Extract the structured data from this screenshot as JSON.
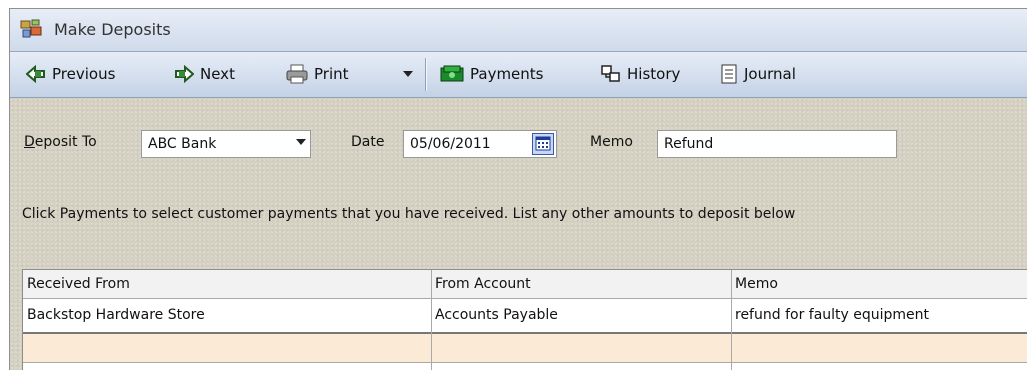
{
  "window": {
    "title": "Make Deposits",
    "icon": "make-deposits-icon"
  },
  "toolbar": {
    "previous_label": "Previous",
    "next_label": "Next",
    "print_label": "Print",
    "payments_label": "Payments",
    "history_label": "History",
    "journal_label": "Journal"
  },
  "form": {
    "deposit_to_label_first": "D",
    "deposit_to_label_rest": "eposit To",
    "deposit_to_value": "ABC Bank",
    "date_label": "Date",
    "date_value": "05/06/2011",
    "memo_label": "Memo",
    "memo_value": "Refund",
    "instructions": "Click Payments to select customer payments that you have received. List any other amounts to deposit below"
  },
  "grid": {
    "columns": [
      "Received From",
      "From Account",
      "Memo"
    ],
    "rows": [
      [
        "Backstop Hardware Store",
        "Accounts Payable",
        "refund for faulty equipment"
      ],
      [
        "",
        "",
        ""
      ]
    ]
  },
  "colors": {
    "form_bg": "#d4d0c2",
    "toolbar_bg": "#c4d2e6",
    "selected_row": "#fbead5"
  }
}
